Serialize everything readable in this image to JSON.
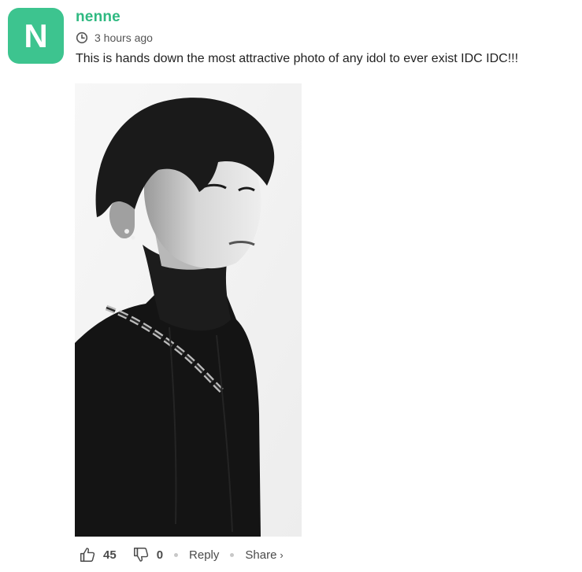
{
  "comment": {
    "avatar_letter": "N",
    "username": "nenne",
    "timestamp": "3 hours ago",
    "body": "This is hands down the most attractive photo of any idol to ever exist IDC IDC!!!",
    "photo": {
      "alt": "Black and white portrait photo",
      "icon": "portrait-photo"
    }
  },
  "actions": {
    "like_count": "45",
    "dislike_count": "0",
    "reply_label": "Reply",
    "share_label": "Share",
    "share_chevron": "›"
  },
  "colors": {
    "avatar_bg": "#3dc48f",
    "username": "#2fb981",
    "text": "#222222",
    "muted": "#555555"
  }
}
